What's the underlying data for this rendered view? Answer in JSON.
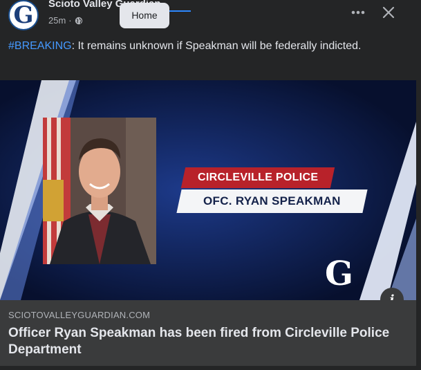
{
  "post": {
    "page_name": "Scioto Valley Guardian",
    "time": "25m",
    "separator": "·",
    "audience_icon": "globe-icon",
    "avatar_letter": "G",
    "tooltip": "Home",
    "more_icon": "more-options-icon",
    "close_icon": "close-icon",
    "hashtag": "#BREAKING",
    "body": ": It remains unknown if Speakman will be federally indicted."
  },
  "media": {
    "lower_third_top": "CIRCLEVILLE POLICE",
    "lower_third_bottom": "OFC. RYAN SPEAKMAN",
    "logo_letter": "G",
    "info_icon": "i"
  },
  "link": {
    "domain": "SCIOTOVALLEYGUARDIAN.COM",
    "title": "Officer Ryan Speakman has been fired from Circleville Police Department"
  },
  "colors": {
    "background": "#242526",
    "link_panel": "#3a3b3c",
    "hashtag": "#4599ff",
    "navy": "#0a1434",
    "red_banner": "#b8222a"
  }
}
